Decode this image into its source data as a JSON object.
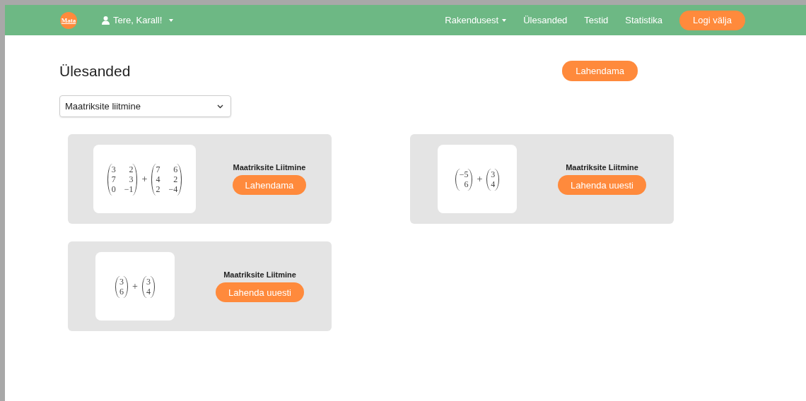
{
  "navbar": {
    "logo": "Mata",
    "user": "Tere, Karall!",
    "links": [
      {
        "label": "Rakendusest",
        "dropdown": true
      },
      {
        "label": "Ülesanded",
        "dropdown": false
      },
      {
        "label": "Testid",
        "dropdown": false
      },
      {
        "label": "Statistika",
        "dropdown": false
      }
    ],
    "logout": "Logi välja"
  },
  "title": "Ülesanded",
  "solve_button": "Lahendama",
  "topic_select": {
    "value": "Maatriksite liitmine"
  },
  "cards": [
    {
      "matrices": [
        [
          [
            "3",
            "2"
          ],
          [
            "7",
            "3"
          ],
          [
            "0",
            "−1"
          ]
        ],
        [
          [
            "7",
            "6"
          ],
          [
            "4",
            "2"
          ],
          [
            "2",
            "−4"
          ]
        ]
      ],
      "operator": "+",
      "title": "Maatriksite Liitmine",
      "button": "Lahendama"
    },
    {
      "matrices": [
        [
          [
            "−5"
          ],
          [
            "6"
          ]
        ],
        [
          [
            "3"
          ],
          [
            "4"
          ]
        ]
      ],
      "operator": "+",
      "title": "Maatriksite Liitmine",
      "button": "Lahenda uuesti"
    },
    {
      "matrices": [
        [
          [
            "3"
          ],
          [
            "6"
          ]
        ],
        [
          [
            "3"
          ],
          [
            "4"
          ]
        ]
      ],
      "operator": "+",
      "title": "Maatriksite Liitmine",
      "button": "Lahenda uuesti"
    }
  ]
}
